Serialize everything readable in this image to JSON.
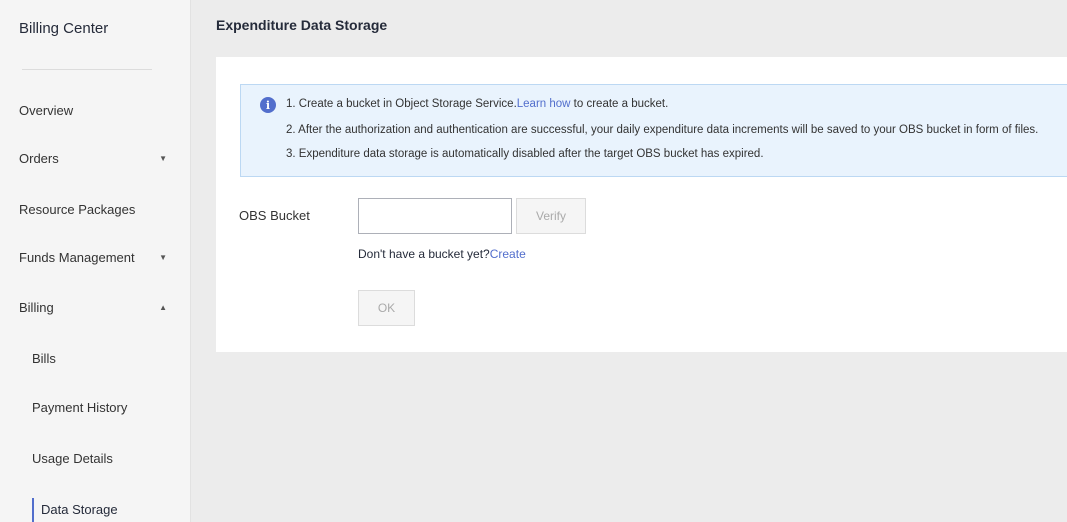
{
  "sidebar": {
    "title": "Billing Center",
    "items": [
      {
        "label": "Overview"
      },
      {
        "label": "Orders",
        "caret": "▼"
      },
      {
        "label": "Resource Packages"
      },
      {
        "label": "Funds Management",
        "caret": "▼"
      },
      {
        "label": "Billing",
        "caret": "▲"
      }
    ],
    "subitems": [
      {
        "label": "Bills"
      },
      {
        "label": "Payment History"
      },
      {
        "label": "Usage Details"
      },
      {
        "label": "Data Storage",
        "active": true
      }
    ]
  },
  "main": {
    "title": "Expenditure Data Storage",
    "notice": {
      "icon": "info-icon",
      "line1_pre": "1. Create a bucket in Object Storage Service.",
      "line1_link": "Learn how",
      "line1_post": " to create a bucket.",
      "line2": "2. After the authorization and authentication are successful, your daily expenditure data increments will be saved to your OBS bucket in form of files.",
      "line3": "3. Expenditure data storage is automatically disabled after the target OBS bucket has expired."
    },
    "form": {
      "label": "OBS Bucket",
      "input_value": "",
      "verify_label": "Verify",
      "hint_text": "Don't have a bucket yet?",
      "hint_link": "Create",
      "ok_label": "OK"
    }
  },
  "colors": {
    "accent": "#526ecc",
    "notice_bg": "#e9f3fd",
    "sidebar_bg": "#f5f5f5",
    "page_bg": "#ececec"
  }
}
